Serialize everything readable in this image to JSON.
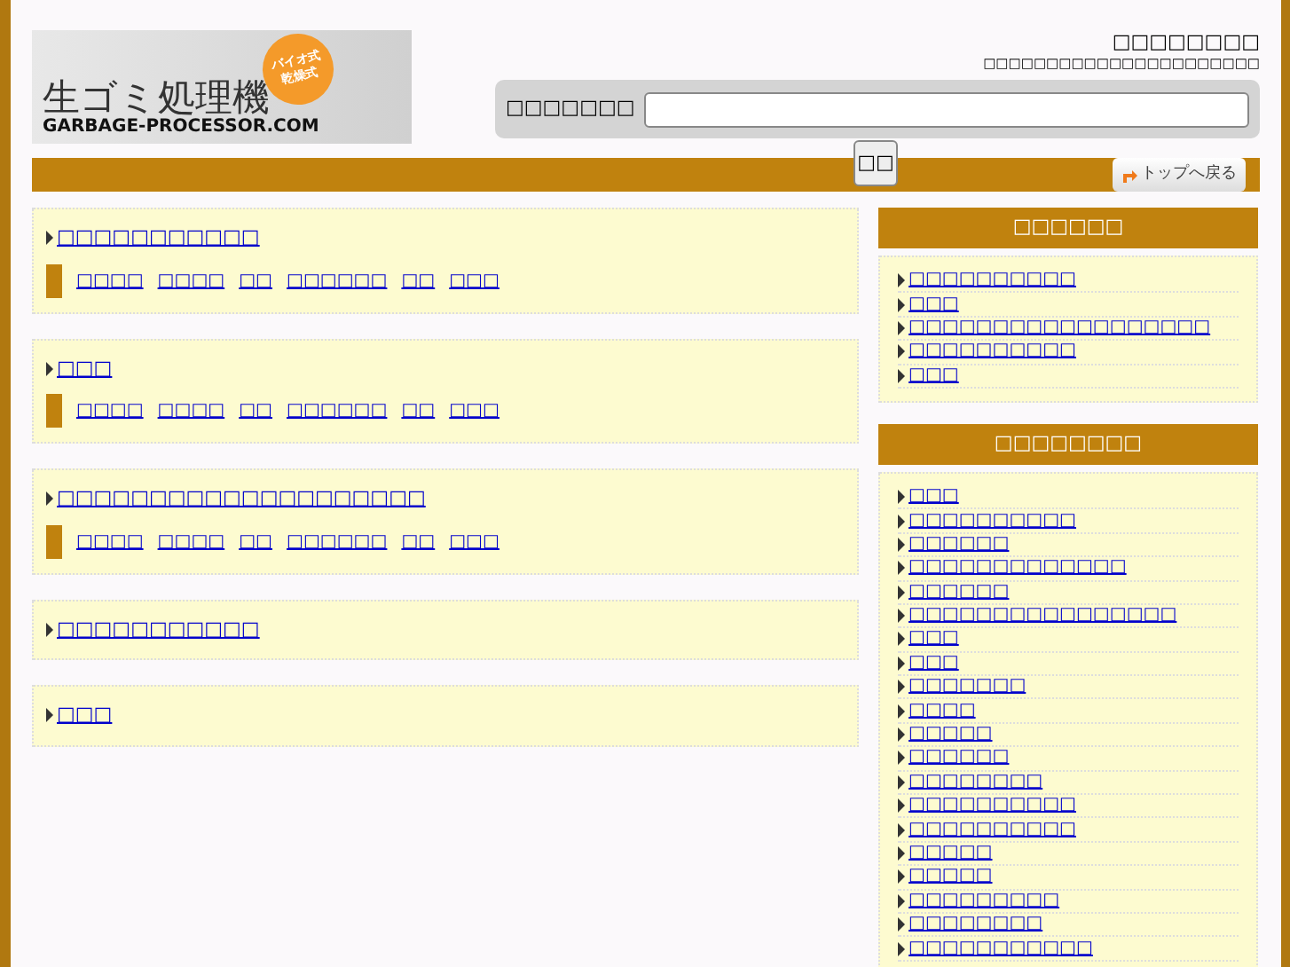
{
  "header": {
    "logo": {
      "title": "生ゴミ処理機",
      "badge": [
        "バイオ式",
        "乾燥式"
      ],
      "domain": "GARBAGE-PROCESSOR.COM"
    },
    "site_title": "□□□□□□□□",
    "tagline": "□□□□□□□□□□□□□□□□□□□□□□",
    "search": {
      "label": "□□□□□□□",
      "button": "□□"
    },
    "top_button": "トップへ戻る"
  },
  "cards": [
    {
      "title": "□□□□□□□□□□□",
      "links": [
        "□□□□",
        "□□□□",
        "□□",
        "□□□□□□",
        "□□",
        "□□□"
      ]
    },
    {
      "title": "□□□",
      "links": [
        "□□□□",
        "□□□□",
        "□□",
        "□□□□□□",
        "□□",
        "□□□"
      ]
    },
    {
      "title": "□□□□□□□□□□□□□□□□□□□□",
      "links": [
        "□□□□",
        "□□□□",
        "□□",
        "□□□□□□",
        "□□",
        "□□□"
      ]
    },
    {
      "title": "□□□□□□□□□□□"
    },
    {
      "title": "□□□"
    }
  ],
  "sidebar": [
    {
      "heading": "□□□□□□",
      "items": [
        "□□□□□□□□□□",
        "□□□",
        "□□□□□□□□□□□□□□□□□□",
        "□□□□□□□□□□",
        "□□□"
      ]
    },
    {
      "heading": "□□□□□□□□",
      "items": [
        "□□□",
        "□□□□□□□□□□",
        "□□□□□□",
        "□□□□□□□□□□□□□",
        "□□□□□□",
        "□□□□□□□□□□□□□□□□",
        "□□□",
        "□□□",
        "□□□□□□□",
        "□□□□",
        "□□□□□",
        "□□□□□□",
        "□□□□□□□□",
        "□□□□□□□□□□",
        "□□□□□□□□□□",
        "□□□□□",
        "□□□□□",
        "□□□□□□□□□",
        "□□□□□□□□",
        "□□□□□□□□□□□"
      ]
    }
  ]
}
